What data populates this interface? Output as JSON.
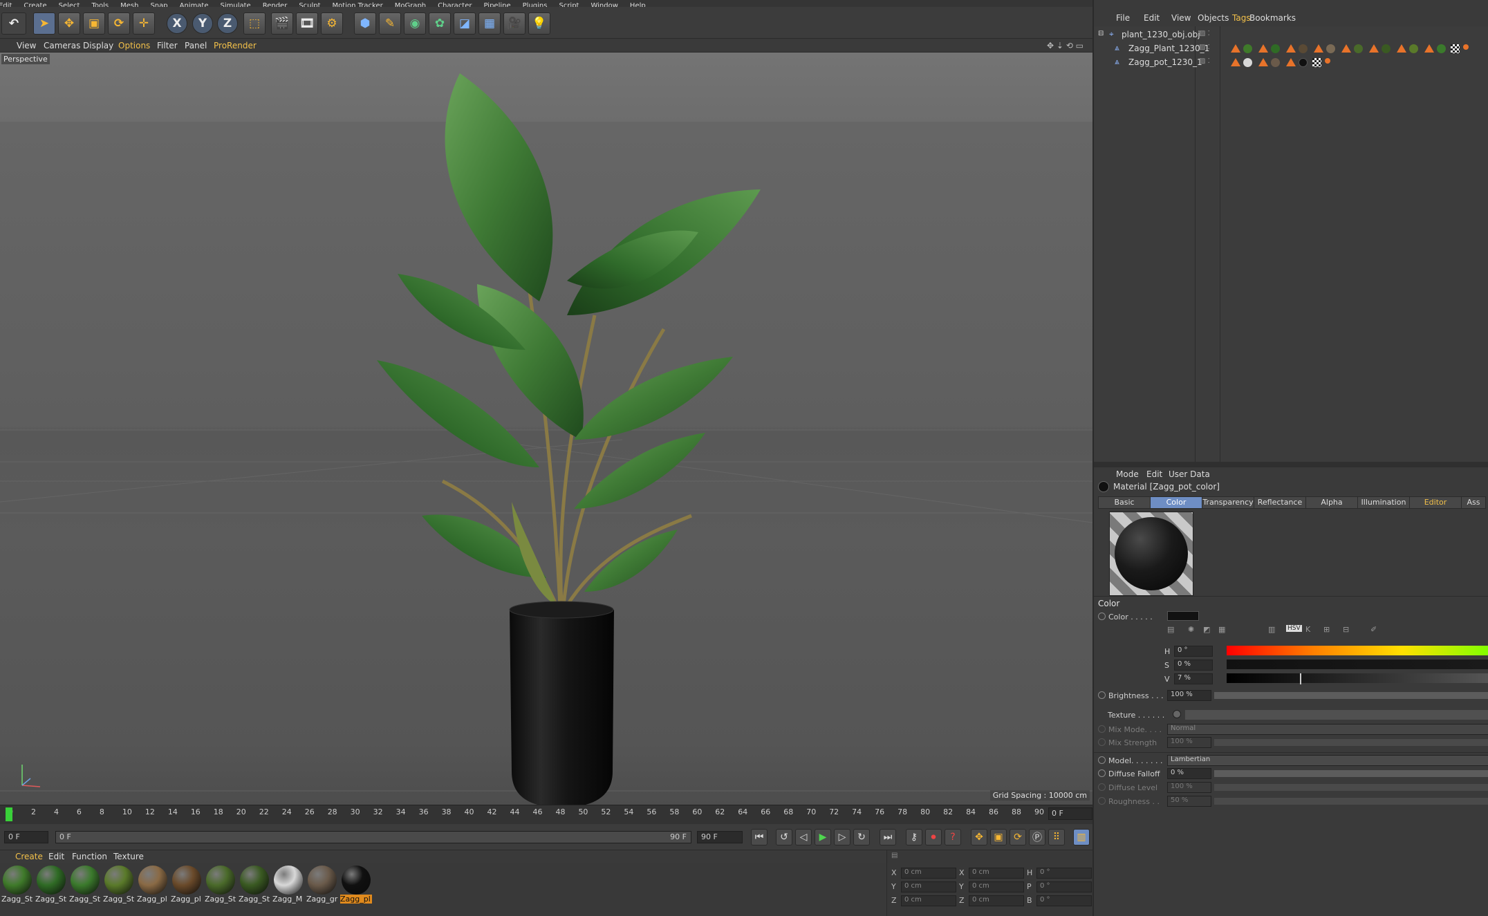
{
  "menubar": [
    "Edit",
    "Create",
    "Select",
    "Tools",
    "Mesh",
    "Snap",
    "Animate",
    "Simulate",
    "Render",
    "Sculpt",
    "Motion Tracker",
    "MoGraph",
    "Character",
    "Pipeline",
    "Plugins",
    "Script",
    "Window",
    "Help"
  ],
  "toolbar": {
    "axis_x": "X",
    "axis_y": "Y",
    "axis_z": "Z"
  },
  "viewport_menu": {
    "view": "View",
    "cameras": "Cameras",
    "display": "Display",
    "options": "Options",
    "filter": "Filter",
    "panel": "Panel",
    "prorender": "ProRender"
  },
  "viewport": {
    "label": "Perspective",
    "grid_spacing": "Grid Spacing : 10000 cm"
  },
  "timeline": {
    "ticks": [
      "0",
      "2",
      "4",
      "6",
      "8",
      "10",
      "12",
      "14",
      "16",
      "18",
      "20",
      "22",
      "24",
      "26",
      "28",
      "30",
      "32",
      "34",
      "36",
      "38",
      "40",
      "42",
      "44",
      "46",
      "48",
      "50",
      "52",
      "54",
      "56",
      "58",
      "60",
      "62",
      "64",
      "66",
      "68",
      "70",
      "72",
      "74",
      "76",
      "78",
      "80",
      "82",
      "84",
      "86",
      "88",
      "90"
    ],
    "current_frame": "0 F"
  },
  "transport": {
    "start": "0 F",
    "range_start": "0 F",
    "range_end": "90 F",
    "end": "90 F"
  },
  "material_manager": {
    "menu": {
      "create": "Create",
      "edit": "Edit",
      "function": "Function",
      "texture": "Texture"
    },
    "materials": [
      {
        "label": "Zagg_St",
        "color": "#3f7a2a"
      },
      {
        "label": "Zagg_St",
        "color": "#2f6b25"
      },
      {
        "label": "Zagg_St",
        "color": "#3b7a2c"
      },
      {
        "label": "Zagg_St",
        "color": "#5a7a2a"
      },
      {
        "label": "Zagg_pl",
        "color": "#8a6a45"
      },
      {
        "label": "Zagg_pl",
        "color": "#6a4a2a"
      },
      {
        "label": "Zagg_St",
        "color": "#4a6a2a"
      },
      {
        "label": "Zagg_St",
        "color": "#3a5a22"
      },
      {
        "label": "Zagg_M",
        "color": "#d8d8d8"
      },
      {
        "label": "Zagg_gr",
        "color": "#6a5a4a"
      },
      {
        "label": "Zagg_pl",
        "color": "#101010"
      }
    ]
  },
  "coordinates": {
    "rows": [
      {
        "a": "X",
        "av": "0 cm",
        "b": "X",
        "bv": "0 cm",
        "c": "H",
        "cv": "0 °"
      },
      {
        "a": "Y",
        "av": "0 cm",
        "b": "Y",
        "bv": "0 cm",
        "c": "P",
        "cv": "0 °"
      },
      {
        "a": "Z",
        "av": "0 cm",
        "b": "Z",
        "bv": "0 cm",
        "c": "B",
        "cv": "0 °"
      }
    ]
  },
  "object_manager": {
    "menu": {
      "file": "File",
      "edit": "Edit",
      "view": "View",
      "objects": "Objects",
      "tags": "Tags",
      "bookmarks": "Bookmarks"
    },
    "objects": [
      {
        "name": "plant_1230_obj.obj"
      },
      {
        "name": "Zagg_Plant_1230_1"
      },
      {
        "name": "Zagg_pot_1230_1"
      }
    ]
  },
  "attributes": {
    "menu": {
      "mode": "Mode",
      "edit": "Edit",
      "user_data": "User Data"
    },
    "material_title": "Material [Zagg_pot_color]",
    "tabs": [
      "Basic",
      "Color",
      "Transparency",
      "Reflectance",
      "Alpha",
      "Illumination",
      "Editor",
      "Ass"
    ],
    "active_tab": "Color",
    "section": "Color",
    "color_label": "Color . . . . .",
    "h_label": "H",
    "h_value": "0 °",
    "s_label": "S",
    "s_value": "0 %",
    "v_label": "V",
    "v_value": "7 %",
    "brightness_label": "Brightness . . .",
    "brightness_value": "100 %",
    "texture_label": "Texture . . . . . .",
    "mix_mode_label": "Mix Mode. . . .",
    "mix_mode_value": "Normal",
    "mix_strength_label": "Mix Strength",
    "mix_strength_value": "100 %",
    "model_label": "Model. . . . . . .",
    "model_value": "Lambertian",
    "diffuse_falloff_label": "Diffuse Falloff",
    "diffuse_falloff_value": "0 %",
    "diffuse_level_label": "Diffuse Level",
    "diffuse_level_value": "100 %",
    "roughness_label": "Roughness . .",
    "roughness_value": "50 %",
    "colors": {
      "active_tab": "#6e8ec4",
      "accent": "#f2c04a",
      "swatch": "#121212"
    }
  }
}
